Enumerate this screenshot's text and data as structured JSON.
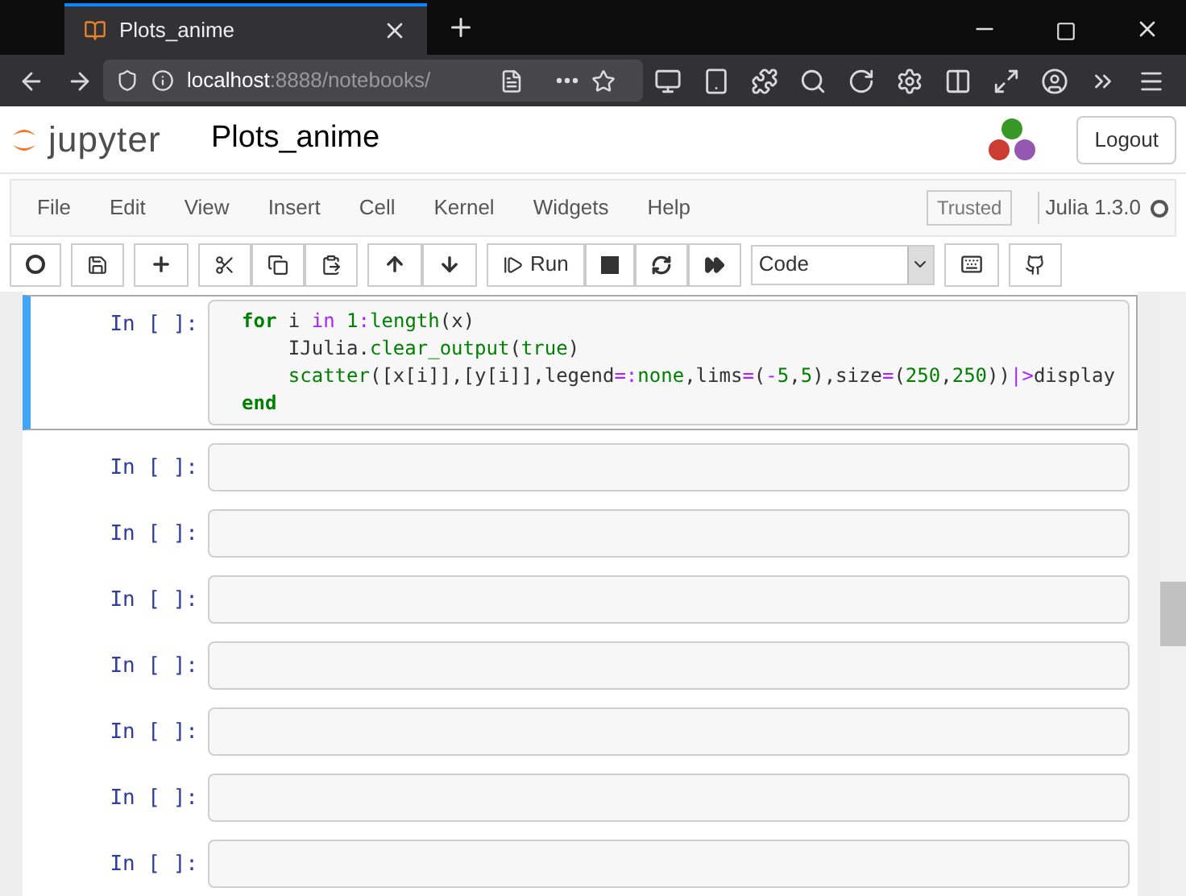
{
  "browser": {
    "tab_title": "Plots_anime",
    "url_host": "localhost",
    "url_rest": ":8888/notebooks/"
  },
  "header": {
    "logo_text": "jupyter",
    "notebook_name": "Plots_anime",
    "logout": "Logout"
  },
  "menu": {
    "items": [
      "File",
      "Edit",
      "View",
      "Insert",
      "Cell",
      "Kernel",
      "Widgets",
      "Help"
    ],
    "trusted": "Trusted",
    "kernel": "Julia 1.3.0",
    "kernel_busy": false
  },
  "toolbar": {
    "run": "Run",
    "cell_type": "Code"
  },
  "cells": [
    {
      "prompt": "In [ ]:",
      "selected": true,
      "lines": [
        [
          {
            "t": "for",
            "kind": "keyword"
          },
          {
            "t": " i ",
            "kind": "plain"
          },
          {
            "t": "in",
            "kind": "operator"
          },
          {
            "t": " 1",
            "kind": "number"
          },
          {
            "t": ":",
            "kind": "operator"
          },
          {
            "t": "length",
            "kind": "builtin"
          },
          {
            "t": "(x)",
            "kind": "plain"
          }
        ],
        [
          {
            "t": "    IJulia.",
            "kind": "plain"
          },
          {
            "t": "clear_output",
            "kind": "builtin"
          },
          {
            "t": "(",
            "kind": "plain"
          },
          {
            "t": "true",
            "kind": "number"
          },
          {
            "t": ")",
            "kind": "plain"
          }
        ],
        [
          {
            "t": "    scatter",
            "kind": "builtin"
          },
          {
            "t": "([x[i]],[y[i]],legend",
            "kind": "plain"
          },
          {
            "t": "=:",
            "kind": "operator"
          },
          {
            "t": "none",
            "kind": "number"
          },
          {
            "t": ",lims",
            "kind": "plain"
          },
          {
            "t": "=",
            "kind": "operator"
          },
          {
            "t": "(",
            "kind": "plain"
          },
          {
            "t": "-",
            "kind": "operator"
          },
          {
            "t": "5",
            "kind": "number"
          },
          {
            "t": ",",
            "kind": "plain"
          },
          {
            "t": "5",
            "kind": "number"
          },
          {
            "t": "),size",
            "kind": "plain"
          },
          {
            "t": "=",
            "kind": "operator"
          },
          {
            "t": "(",
            "kind": "plain"
          },
          {
            "t": "250",
            "kind": "number"
          },
          {
            "t": ",",
            "kind": "plain"
          },
          {
            "t": "250",
            "kind": "number"
          },
          {
            "t": "))",
            "kind": "plain"
          },
          {
            "t": "|>",
            "kind": "operator"
          },
          {
            "t": "display",
            "kind": "plain"
          }
        ],
        [
          {
            "t": "end",
            "kind": "keyword"
          }
        ]
      ]
    },
    {
      "prompt": "In [ ]:",
      "selected": false
    },
    {
      "prompt": "In [ ]:",
      "selected": false
    },
    {
      "prompt": "In [ ]:",
      "selected": false
    },
    {
      "prompt": "In [ ]:",
      "selected": false
    },
    {
      "prompt": "In [ ]:",
      "selected": false
    },
    {
      "prompt": "In [ ]:",
      "selected": false
    },
    {
      "prompt": "In [ ]:",
      "selected": false
    }
  ]
}
